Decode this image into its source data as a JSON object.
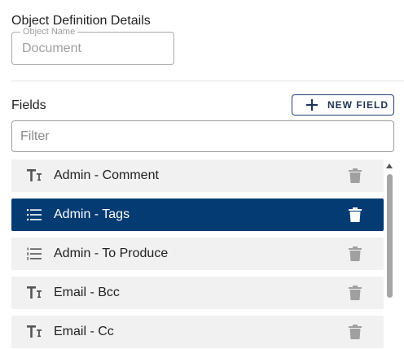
{
  "section": {
    "title": "Object Definition Details"
  },
  "object_name": {
    "label": "Object Name",
    "value": "Document"
  },
  "fields": {
    "label": "Fields",
    "new_field_button": "NEW FIELD",
    "filter_placeholder": "Filter",
    "items": [
      {
        "label": "Admin - Comment",
        "type_icon": "text-field-icon",
        "selected": false
      },
      {
        "label": "Admin - Tags",
        "type_icon": "list-field-icon",
        "selected": true
      },
      {
        "label": "Admin - To Produce",
        "type_icon": "numbered-list-field-icon",
        "selected": false
      },
      {
        "label": "Email - Bcc",
        "type_icon": "text-field-icon",
        "selected": false
      },
      {
        "label": "Email - Cc",
        "type_icon": "text-field-icon",
        "selected": false
      }
    ]
  },
  "colors": {
    "selected_row": "#053b73",
    "row_background": "#f1f1f1",
    "button_border": "#1f3f73",
    "trash_icon": "#a0a0a0"
  }
}
